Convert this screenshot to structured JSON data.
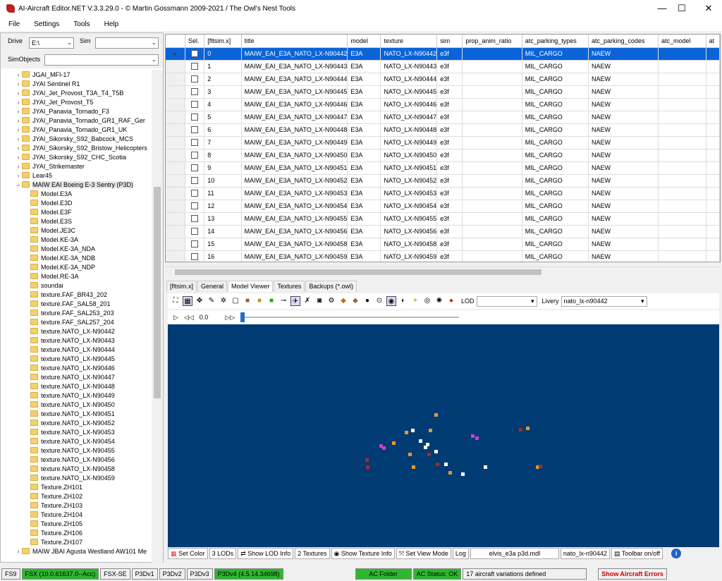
{
  "window": {
    "title": "AI-Aircraft Editor.NET V.3.3.29.0 - © Martin Gossmann 2009-2021 / The Owl's Nest Tools",
    "minimize": "—",
    "maximize": "☐",
    "close": "✕"
  },
  "menu": [
    "File",
    "Settings",
    "Tools",
    "Help"
  ],
  "left": {
    "drive_label": "Drive",
    "drive_value": "E:\\",
    "sim_label": "Sim",
    "sim_value": "",
    "simobjects_label": "SimObjects",
    "simobjects_value": "",
    "tree": [
      {
        "label": "JGAI_MFI-17",
        "depth": 0,
        "exp": ">"
      },
      {
        "label": "JYAI Sentinel R1",
        "depth": 0,
        "exp": ">"
      },
      {
        "label": "JYAI_Jet_Provost_T3A_T4_T5B",
        "depth": 0,
        "exp": ">"
      },
      {
        "label": "JYAI_Jet_Provost_T5",
        "depth": 0,
        "exp": ">"
      },
      {
        "label": "JYAI_Panavia_Tornado_F3",
        "depth": 0,
        "exp": ">"
      },
      {
        "label": "JYAI_Panavia_Tornado_GR1_RAF_Ger",
        "depth": 0,
        "exp": ">"
      },
      {
        "label": "JYAI_Panavia_Tornado_GR1_UK",
        "depth": 0,
        "exp": ">"
      },
      {
        "label": "JYAI_Sikorsky_S92_Babcock_MCS",
        "depth": 0,
        "exp": ">"
      },
      {
        "label": "JYAI_Sikorsky_S92_Bristow_Helicopters",
        "depth": 0,
        "exp": ">"
      },
      {
        "label": "JYAI_Sikorsky_S92_CHC_Scotia",
        "depth": 0,
        "exp": ">"
      },
      {
        "label": "JYAI_Strikemaster",
        "depth": 0,
        "exp": ">"
      },
      {
        "label": "Lear45",
        "depth": 0,
        "exp": ">"
      },
      {
        "label": "MAIW EAI Boeing E-3 Sentry (P3D)",
        "depth": 0,
        "exp": "v",
        "selected": true
      },
      {
        "label": "Model.E3A",
        "depth": 1,
        "exp": ""
      },
      {
        "label": "Model.E3D",
        "depth": 1,
        "exp": ""
      },
      {
        "label": "Model.E3F",
        "depth": 1,
        "exp": ""
      },
      {
        "label": "Model.E3S",
        "depth": 1,
        "exp": ""
      },
      {
        "label": "Model.JE3C",
        "depth": 1,
        "exp": ""
      },
      {
        "label": "Model.KE-3A",
        "depth": 1,
        "exp": ""
      },
      {
        "label": "Model.KE-3A_NDA",
        "depth": 1,
        "exp": ""
      },
      {
        "label": "Model.KE-3A_NDB",
        "depth": 1,
        "exp": ""
      },
      {
        "label": "Model.KE-3A_NDP",
        "depth": 1,
        "exp": ""
      },
      {
        "label": "Model.RE-3A",
        "depth": 1,
        "exp": ""
      },
      {
        "label": "soundai",
        "depth": 1,
        "exp": ""
      },
      {
        "label": "texture.FAF_BR43_202",
        "depth": 1,
        "exp": ""
      },
      {
        "label": "texture.FAF_SAL58_201",
        "depth": 1,
        "exp": ""
      },
      {
        "label": "texture.FAF_SAL253_203",
        "depth": 1,
        "exp": ""
      },
      {
        "label": "texture.FAF_SAL257_204",
        "depth": 1,
        "exp": ""
      },
      {
        "label": "texture.NATO_LX-N90442",
        "depth": 1,
        "exp": ""
      },
      {
        "label": "texture.NATO_LX-N90443",
        "depth": 1,
        "exp": ""
      },
      {
        "label": "texture.NATO_LX-N90444",
        "depth": 1,
        "exp": ""
      },
      {
        "label": "texture.NATO_LX-N90445",
        "depth": 1,
        "exp": ""
      },
      {
        "label": "texture.NATO_LX-N90446",
        "depth": 1,
        "exp": ""
      },
      {
        "label": "texture.NATO_LX-N90447",
        "depth": 1,
        "exp": ""
      },
      {
        "label": "texture.NATO_LX-N90448",
        "depth": 1,
        "exp": ""
      },
      {
        "label": "texture.NATO_LX-N90449",
        "depth": 1,
        "exp": ""
      },
      {
        "label": "texture.NATO_LX-N90450",
        "depth": 1,
        "exp": ""
      },
      {
        "label": "texture.NATO_LX-N90451",
        "depth": 1,
        "exp": ""
      },
      {
        "label": "texture.NATO_LX-N90452",
        "depth": 1,
        "exp": ""
      },
      {
        "label": "texture.NATO_LX-N90453",
        "depth": 1,
        "exp": ""
      },
      {
        "label": "texture.NATO_LX-N90454",
        "depth": 1,
        "exp": ""
      },
      {
        "label": "texture.NATO_LX-N90455",
        "depth": 1,
        "exp": ""
      },
      {
        "label": "texture.NATO_LX-N90456",
        "depth": 1,
        "exp": ""
      },
      {
        "label": "texture.NATO_LX-N90458",
        "depth": 1,
        "exp": ""
      },
      {
        "label": "texture.NATO_LX-N90459",
        "depth": 1,
        "exp": ""
      },
      {
        "label": "Texture.ZH101",
        "depth": 1,
        "exp": ""
      },
      {
        "label": "Texture.ZH102",
        "depth": 1,
        "exp": ""
      },
      {
        "label": "Texture.ZH103",
        "depth": 1,
        "exp": ""
      },
      {
        "label": "Texture.ZH104",
        "depth": 1,
        "exp": ""
      },
      {
        "label": "Texture.ZH105",
        "depth": 1,
        "exp": ""
      },
      {
        "label": "Texture.ZH106",
        "depth": 1,
        "exp": ""
      },
      {
        "label": "Texture.ZH107",
        "depth": 1,
        "exp": ""
      },
      {
        "label": "MAIW JBAI Agusta Westland AW101 Me",
        "depth": 0,
        "exp": ">"
      }
    ]
  },
  "grid": {
    "columns": [
      "",
      "Sel.",
      "[fltsim.x]",
      "title",
      "model",
      "texture",
      "sim",
      "prop_anim_ratio",
      "atc_parking_types",
      "atc_parking_codes",
      "atc_model",
      "at"
    ],
    "rows": [
      [
        "0",
        "MAIW_EAI_E3A_NATO_LX-N90442",
        "E3A",
        "NATO_LX-N90442",
        "e3f",
        "",
        "MIL_CARGO",
        "NAEW",
        ""
      ],
      [
        "1",
        "MAIW_EAI_E3A_NATO_LX-N90443",
        "E3A",
        "NATO_LX-N90443",
        "e3f",
        "",
        "MIL_CARGO",
        "NAEW",
        ""
      ],
      [
        "2",
        "MAIW_EAI_E3A_NATO_LX-N90444",
        "E3A",
        "NATO_LX-N90444",
        "e3f",
        "",
        "MIL_CARGO",
        "NAEW",
        ""
      ],
      [
        "3",
        "MAIW_EAI_E3A_NATO_LX-N90445",
        "E3A",
        "NATO_LX-N90445",
        "e3f",
        "",
        "MIL_CARGO",
        "NAEW",
        ""
      ],
      [
        "4",
        "MAIW_EAI_E3A_NATO_LX-N90446",
        "E3A",
        "NATO_LX-N90446",
        "e3f",
        "",
        "MIL_CARGO",
        "NAEW",
        ""
      ],
      [
        "5",
        "MAIW_EAI_E3A_NATO_LX-N90447",
        "E3A",
        "NATO_LX-N90447",
        "e3f",
        "",
        "MIL_CARGO",
        "NAEW",
        ""
      ],
      [
        "6",
        "MAIW_EAI_E3A_NATO_LX-N90448",
        "E3A",
        "NATO_LX-N90448",
        "e3f",
        "",
        "MIL_CARGO",
        "NAEW",
        ""
      ],
      [
        "7",
        "MAIW_EAI_E3A_NATO_LX-N90449",
        "E3A",
        "NATO_LX-N90449",
        "e3f",
        "",
        "MIL_CARGO",
        "NAEW",
        ""
      ],
      [
        "8",
        "MAIW_EAI_E3A_NATO_LX-N90450",
        "E3A",
        "NATO_LX-N90450",
        "e3f",
        "",
        "MIL_CARGO",
        "NAEW",
        ""
      ],
      [
        "9",
        "MAIW_EAI_E3A_NATO_LX-N90451",
        "E3A",
        "NATO_LX-N90451",
        "e3f",
        "",
        "MIL_CARGO",
        "NAEW",
        ""
      ],
      [
        "10",
        "MAIW_EAI_E3A_NATO_LX-N90452",
        "E3A",
        "NATO_LX-N90452",
        "e3f",
        "",
        "MIL_CARGO",
        "NAEW",
        ""
      ],
      [
        "11",
        "MAIW_EAI_E3A_NATO_LX-N90453",
        "E3A",
        "NATO_LX-N90453",
        "e3f",
        "",
        "MIL_CARGO",
        "NAEW",
        ""
      ],
      [
        "12",
        "MAIW_EAI_E3A_NATO_LX-N90454",
        "E3A",
        "NATO_LX-N90454",
        "e3f",
        "",
        "MIL_CARGO",
        "NAEW",
        ""
      ],
      [
        "13",
        "MAIW_EAI_E3A_NATO_LX-N90455",
        "E3A",
        "NATO_LX-N90455",
        "e3f",
        "",
        "MIL_CARGO",
        "NAEW",
        ""
      ],
      [
        "14",
        "MAIW_EAI_E3A_NATO_LX-N90456",
        "E3A",
        "NATO_LX-N90456",
        "e3f",
        "",
        "MIL_CARGO",
        "NAEW",
        ""
      ],
      [
        "15",
        "MAIW_EAI_E3A_NATO_LX-N90458",
        "E3A",
        "NATO_LX-N90458",
        "e3f",
        "",
        "MIL_CARGO",
        "NAEW",
        ""
      ],
      [
        "16",
        "MAIW_EAI_E3A_NATO_LX-N90459",
        "E3A",
        "NATO_LX-N90459",
        "e3f",
        "",
        "MIL_CARGO",
        "NAEW",
        ""
      ]
    ],
    "selected_color": "#0a64d8"
  },
  "tabs": [
    "[fltsim.x]",
    "General",
    "Model Viewer",
    "Textures",
    "Backups (*.owl)"
  ],
  "toolbar": {
    "lod_label": "LOD",
    "lod_value": "",
    "livery_label": "Livery",
    "livery_value": "nato_lx-n90442"
  },
  "playback": {
    "value": "0.0",
    "position_fraction": 0
  },
  "viewer": {
    "background": "#003b74"
  },
  "bottom": {
    "set_color": "Set Color",
    "lods": "3 LODs",
    "show_lod_info": "Show LOD Info",
    "textures": "2 Textures",
    "show_texture_info": "Show Texture Info",
    "set_view_mode": "Set View Mode",
    "log": "Log",
    "mdl_file": "elvis_e3a p3d.mdl",
    "livery_file": "nato_lx-n90442",
    "toolbar_toggle": "Toolbar on/off"
  },
  "status": {
    "fs9": "FS9",
    "fsx": "FSX (10.0.61637.0--Acc)",
    "fsxse": "FSX-SE",
    "p3dv1": "P3Dv1",
    "p3dv2": "P3Dv2",
    "p3dv3": "P3Dv3",
    "p3dv4": "P3Dv4 (4.5.14.34698)",
    "ac_folder": "AC Folder",
    "ac_status": "AC Status: OK",
    "variations": "17 aircraft variations defined",
    "errors": "Show Aircraft Errors"
  }
}
